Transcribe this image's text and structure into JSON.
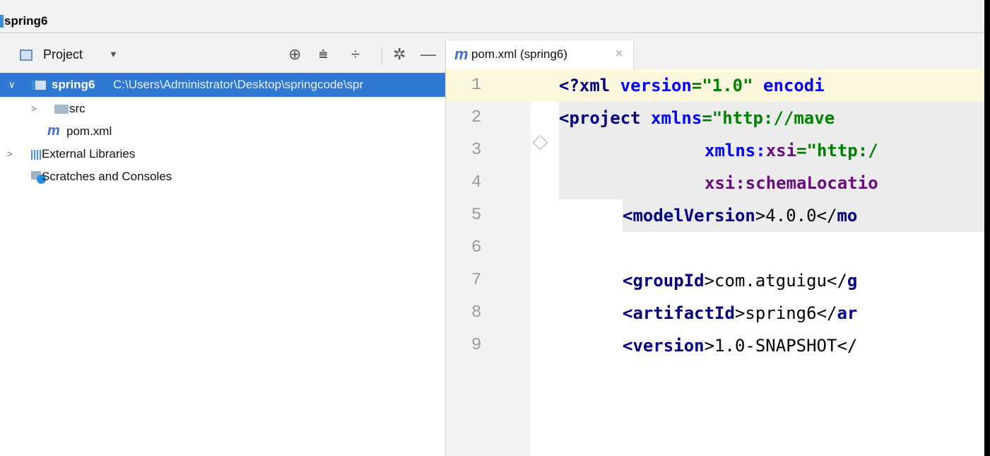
{
  "window": {
    "title": "spring6"
  },
  "project_pane": {
    "view_label": "Project",
    "tree": [
      {
        "label": "spring6",
        "path": "C:\\Users\\Administrator\\Desktop\\springcode\\spr"
      },
      {
        "label": "src"
      },
      {
        "label": "pom.xml"
      },
      {
        "label": "External Libraries"
      },
      {
        "label": "Scratches and Consoles"
      }
    ]
  },
  "editor": {
    "tab_label": "pom.xml (spring6)",
    "line_numbers": [
      "1",
      "2",
      "3",
      "4",
      "5",
      "6",
      "7",
      "8",
      "9"
    ],
    "lines": [
      {
        "p1": "<?",
        "p2": "xml",
        "p3": " version",
        "p4": "=\"1.0\"",
        "p5": " encodi"
      },
      {
        "p1": "<",
        "p2": "project",
        "p3": " xmlns",
        "p4": "=\"http://mave"
      },
      {
        "p1": "xmlns:",
        "p2": "xsi",
        "p3": "=\"http:/"
      },
      {
        "p1": "xsi",
        "p2": ":schemaLocatio"
      },
      {
        "p1": "<",
        "p2": "modelVersion",
        "p3": ">4.0.0</",
        "p4": "mo"
      },
      {},
      {
        "p1": "<",
        "p2": "groupId",
        "p3": ">com.atguigu</",
        "p4": "g"
      },
      {
        "p1": "<",
        "p2": "artifactId",
        "p3": ">spring6</",
        "p4": "ar"
      },
      {
        "p1": "<",
        "p2": "version",
        "p3": ">1.0-SNAPSHOT</"
      }
    ]
  },
  "colors": {
    "selection": "#2f78d3",
    "current_line": "#fdf7de",
    "tag": "#000080",
    "string": "#008000",
    "namespace": "#660e7a"
  }
}
